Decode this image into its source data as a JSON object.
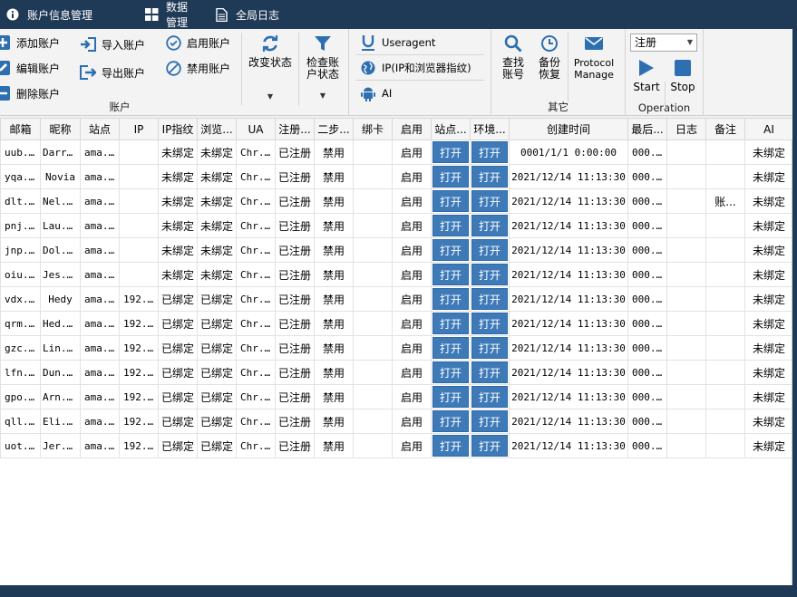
{
  "top_tabs": [
    {
      "label": "账户信息管理",
      "icon": "info-icon"
    },
    {
      "label": "数据管理",
      "icon": "grid-icon"
    },
    {
      "label": "全局日志",
      "icon": "document-icon"
    }
  ],
  "ribbon": {
    "account_group": {
      "label": "账户",
      "add": "添加账户",
      "edit": "编辑账户",
      "delete": "删除账户",
      "import": "导入账户",
      "export": "导出账户",
      "enable": "启用账户",
      "disable": "禁用账户",
      "change_status": "改变状态",
      "check_status": "检查账\n户状态"
    },
    "fingerprint_group": {
      "useragent": "Useragent",
      "ip": "IP(IP和浏览器指纹)",
      "ai": "AI"
    },
    "other_group": {
      "label": "其它",
      "search": "查找\n账号",
      "backup": "备份\n恢复",
      "protocol": "Protocol\nManage"
    },
    "operation_group": {
      "label": "Operation",
      "combo_value": "注册",
      "start": "Start",
      "stop": "Stop"
    }
  },
  "table": {
    "columns": [
      "邮箱",
      "昵称",
      "站点",
      "IP",
      "IP指纹",
      "浏览...",
      "UA",
      "注册...",
      "二步...",
      "绑卡",
      "启用",
      "站点...",
      "环境...",
      "创建时间",
      "最后...",
      "日志",
      "备注",
      "AI"
    ],
    "open_label": "打开",
    "rows": [
      {
        "email": "uub...",
        "nick": "Darren",
        "site": "ama...",
        "ip": "",
        "ipfp": "未绑定",
        "browser": "未绑定",
        "ua": "Chr...",
        "reg": "已注册",
        "twostep": "禁用",
        "card": "",
        "enabled": "启用",
        "created": "0001/1/1  0:00:00",
        "last": "000...",
        "log": "",
        "note": "",
        "ai": "未绑定"
      },
      {
        "email": "yqa...",
        "nick": "Novia",
        "site": "ama...",
        "ip": "",
        "ipfp": "未绑定",
        "browser": "未绑定",
        "ua": "Chr...",
        "reg": "已注册",
        "twostep": "禁用",
        "card": "",
        "enabled": "启用",
        "created": "2021/12/14 11:13:30",
        "last": "000...",
        "log": "",
        "note": "",
        "ai": "未绑定"
      },
      {
        "email": "dlt...",
        "nick": "Nel...",
        "site": "ama...",
        "ip": "",
        "ipfp": "未绑定",
        "browser": "未绑定",
        "ua": "Chr...",
        "reg": "已注册",
        "twostep": "禁用",
        "card": "",
        "enabled": "启用",
        "created": "2021/12/14 11:13:30",
        "last": "000...",
        "log": "",
        "note": "账...",
        "ai": "未绑定"
      },
      {
        "email": "pnj...",
        "nick": "Lau...",
        "site": "ama...",
        "ip": "",
        "ipfp": "未绑定",
        "browser": "未绑定",
        "ua": "Chr...",
        "reg": "已注册",
        "twostep": "禁用",
        "card": "",
        "enabled": "启用",
        "created": "2021/12/14 11:13:30",
        "last": "000...",
        "log": "",
        "note": "",
        "ai": "未绑定"
      },
      {
        "email": "jnp...",
        "nick": "Dol...",
        "site": "ama...",
        "ip": "",
        "ipfp": "未绑定",
        "browser": "未绑定",
        "ua": "Chr...",
        "reg": "已注册",
        "twostep": "禁用",
        "card": "",
        "enabled": "启用",
        "created": "2021/12/14 11:13:30",
        "last": "000...",
        "log": "",
        "note": "",
        "ai": "未绑定"
      },
      {
        "email": "oiu...",
        "nick": "Jes...",
        "site": "ama...",
        "ip": "",
        "ipfp": "未绑定",
        "browser": "未绑定",
        "ua": "Chr...",
        "reg": "已注册",
        "twostep": "禁用",
        "card": "",
        "enabled": "启用",
        "created": "2021/12/14 11:13:30",
        "last": "000...",
        "log": "",
        "note": "",
        "ai": "未绑定"
      },
      {
        "email": "vdx...",
        "nick": "Hedy",
        "site": "ama...",
        "ip": "192...",
        "ipfp": "已绑定",
        "browser": "已绑定",
        "ua": "Chr...",
        "reg": "已注册",
        "twostep": "禁用",
        "card": "",
        "enabled": "启用",
        "created": "2021/12/14 11:13:30",
        "last": "000...",
        "log": "",
        "note": "",
        "ai": "未绑定"
      },
      {
        "email": "qrm...",
        "nick": "Hed...",
        "site": "ama...",
        "ip": "192...",
        "ipfp": "已绑定",
        "browser": "已绑定",
        "ua": "Chr...",
        "reg": "已注册",
        "twostep": "禁用",
        "card": "",
        "enabled": "启用",
        "created": "2021/12/14 11:13:30",
        "last": "000...",
        "log": "",
        "note": "",
        "ai": "未绑定"
      },
      {
        "email": "gzc...",
        "nick": "Lin...",
        "site": "ama...",
        "ip": "192...",
        "ipfp": "已绑定",
        "browser": "已绑定",
        "ua": "Chr...",
        "reg": "已注册",
        "twostep": "禁用",
        "card": "",
        "enabled": "启用",
        "created": "2021/12/14 11:13:30",
        "last": "000...",
        "log": "",
        "note": "",
        "ai": "未绑定"
      },
      {
        "email": "lfn...",
        "nick": "Dun...",
        "site": "ama...",
        "ip": "192...",
        "ipfp": "已绑定",
        "browser": "已绑定",
        "ua": "Chr...",
        "reg": "已注册",
        "twostep": "禁用",
        "card": "",
        "enabled": "启用",
        "created": "2021/12/14 11:13:30",
        "last": "000...",
        "log": "",
        "note": "",
        "ai": "未绑定"
      },
      {
        "email": "gpo...",
        "nick": "Arn...",
        "site": "ama...",
        "ip": "192...",
        "ipfp": "已绑定",
        "browser": "已绑定",
        "ua": "Chr...",
        "reg": "已注册",
        "twostep": "禁用",
        "card": "",
        "enabled": "启用",
        "created": "2021/12/14 11:13:30",
        "last": "000...",
        "log": "",
        "note": "",
        "ai": "未绑定"
      },
      {
        "email": "qll...",
        "nick": "Eli...",
        "site": "ama...",
        "ip": "192...",
        "ipfp": "已绑定",
        "browser": "已绑定",
        "ua": "Chr...",
        "reg": "已注册",
        "twostep": "禁用",
        "card": "",
        "enabled": "启用",
        "created": "2021/12/14 11:13:30",
        "last": "000...",
        "log": "",
        "note": "",
        "ai": "未绑定"
      },
      {
        "email": "uot...",
        "nick": "Jer...",
        "site": "ama...",
        "ip": "192...",
        "ipfp": "已绑定",
        "browser": "已绑定",
        "ua": "Chr...",
        "reg": "已注册",
        "twostep": "禁用",
        "card": "",
        "enabled": "启用",
        "created": "2021/12/14 11:13:30",
        "last": "000...",
        "log": "",
        "note": "",
        "ai": "未绑定"
      }
    ]
  },
  "colors": {
    "title_bar": "#1f3a56",
    "accent_blue": "#3e7ab8",
    "icon_blue": "#2d6fb0"
  }
}
